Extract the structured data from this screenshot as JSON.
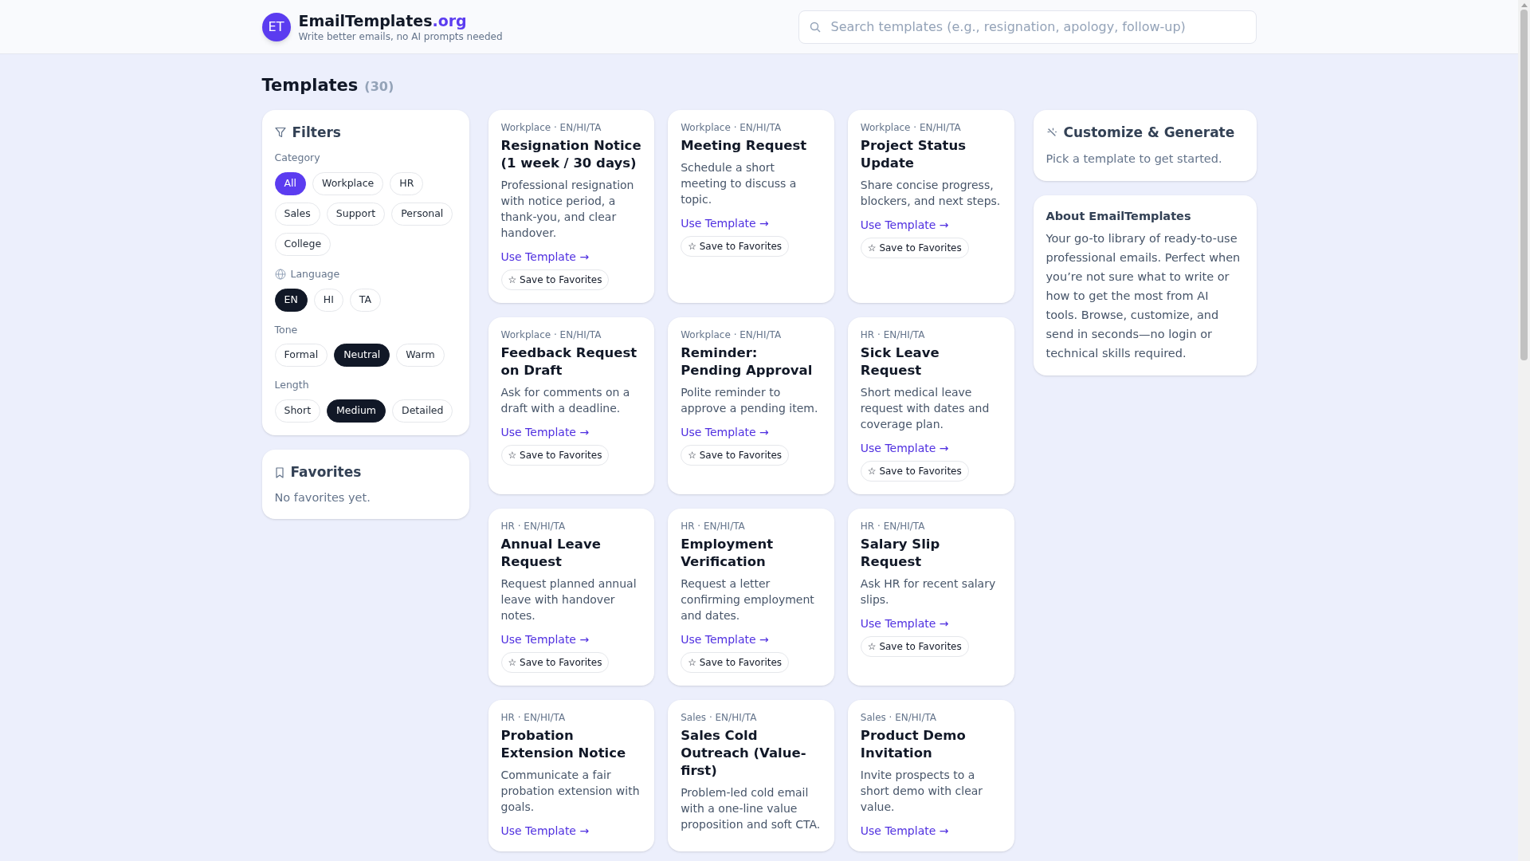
{
  "header": {
    "logo": "ET",
    "brand": "EmailTemplates",
    "brand_suffix": ".org",
    "tagline": "Write better emails, no AI prompts needed",
    "search": {
      "placeholder": "Search templates (e.g., resignation, apology, follow-up)"
    }
  },
  "heading": {
    "title": "Templates",
    "count": "(30)"
  },
  "filters": {
    "title": "Filters",
    "groups": [
      {
        "label": "Category",
        "kind": "accent",
        "options": [
          {
            "label": "All",
            "selected": true
          },
          {
            "label": "Workplace",
            "selected": false
          },
          {
            "label": "HR",
            "selected": false
          },
          {
            "label": "Sales",
            "selected": false
          },
          {
            "label": "Support",
            "selected": false
          },
          {
            "label": "Personal",
            "selected": false
          },
          {
            "label": "College",
            "selected": false
          }
        ]
      },
      {
        "label": "Language",
        "kind": "plain",
        "options": [
          {
            "label": "EN",
            "selected": true
          },
          {
            "label": "HI",
            "selected": false
          },
          {
            "label": "TA",
            "selected": false
          }
        ]
      },
      {
        "label": "Tone",
        "kind": "plain",
        "options": [
          {
            "label": "Formal",
            "selected": false
          },
          {
            "label": "Neutral",
            "selected": true
          },
          {
            "label": "Warm",
            "selected": false
          }
        ]
      },
      {
        "label": "Length",
        "kind": "plain",
        "options": [
          {
            "label": "Short",
            "selected": false
          },
          {
            "label": "Medium",
            "selected": true
          },
          {
            "label": "Detailed",
            "selected": false
          }
        ]
      }
    ]
  },
  "favorites": {
    "title": "Favorites",
    "empty": "No favorites yet."
  },
  "templates": [
    {
      "meta": "Workplace · EN/HI/TA",
      "title": "Resignation Notice (1 week / 30 days)",
      "description": "Professional resignation with notice period, a thank-you, and clear handover.",
      "link": "Use Template →",
      "save": "☆ Save to Favorites"
    },
    {
      "meta": "Workplace · EN/HI/TA",
      "title": "Meeting Request",
      "description": "Schedule a short meeting to discuss a topic.",
      "link": "Use Template →",
      "save": "☆ Save to Favorites"
    },
    {
      "meta": "Workplace · EN/HI/TA",
      "title": "Project Status Update",
      "description": "Share concise progress, blockers, and next steps.",
      "link": "Use Template →",
      "save": "☆ Save to Favorites"
    },
    {
      "meta": "Workplace · EN/HI/TA",
      "title": "Feedback Request on Draft",
      "description": "Ask for comments on a draft with a deadline.",
      "link": "Use Template →",
      "save": "☆ Save to Favorites"
    },
    {
      "meta": "Workplace · EN/HI/TA",
      "title": "Reminder: Pending Approval",
      "description": "Polite reminder to approve a pending item.",
      "link": "Use Template →",
      "save": "☆ Save to Favorites"
    },
    {
      "meta": "HR · EN/HI/TA",
      "title": "Sick Leave Request",
      "description": "Short medical leave request with dates and coverage plan.",
      "link": "Use Template →",
      "save": "☆ Save to Favorites"
    },
    {
      "meta": "HR · EN/HI/TA",
      "title": "Annual Leave Request",
      "description": "Request planned annual leave with handover notes.",
      "link": "Use Template →",
      "save": "☆ Save to Favorites"
    },
    {
      "meta": "HR · EN/HI/TA",
      "title": "Employment Verification",
      "description": "Request a letter confirming employment and dates.",
      "link": "Use Template →",
      "save": "☆ Save to Favorites"
    },
    {
      "meta": "HR · EN/HI/TA",
      "title": "Salary Slip Request",
      "description": "Ask HR for recent salary slips.",
      "link": "Use Template →",
      "save": "☆ Save to Favorites"
    },
    {
      "meta": "HR · EN/HI/TA",
      "title": "Probation Extension Notice",
      "description": "Communicate a fair probation extension with goals.",
      "link": "Use Template →"
    },
    {
      "meta": "Sales · EN/HI/TA",
      "title": "Sales Cold Outreach (Value-first)",
      "description": "Problem-led cold email with a one-line value proposition and soft CTA."
    },
    {
      "meta": "Sales · EN/HI/TA",
      "title": "Product Demo Invitation",
      "description": "Invite prospects to a short demo with clear value.",
      "link": "Use Template →"
    }
  ],
  "customize": {
    "title": "Customize & Generate",
    "hint": "Pick a template to get started."
  },
  "about": {
    "title": "About EmailTemplates",
    "text": "Your go-to library of ready-to-use professional emails. Perfect when you’re not sure what to write or how to get the most from AI tools. Browse, customize, and send in seconds—no login or technical skills required."
  }
}
